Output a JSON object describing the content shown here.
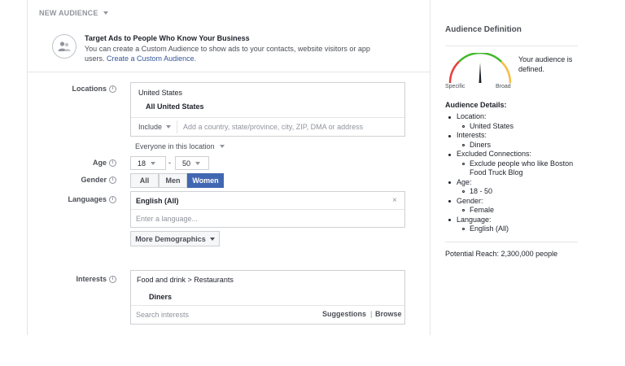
{
  "header": {
    "title": "NEW AUDIENCE"
  },
  "custom_audience": {
    "title": "Target Ads to People Who Know Your Business",
    "text": "You can create a Custom Audience to show ads to your contacts, website visitors or app users.",
    "link": "Create a Custom Audience."
  },
  "locations": {
    "label": "Locations",
    "country": "United States",
    "selected": "All United States",
    "include": "Include",
    "placeholder": "Add a country, state/province, city, ZIP, DMA or address",
    "everyone": "Everyone in this location"
  },
  "age": {
    "label": "Age",
    "min": "18",
    "dash": "-",
    "max": "50"
  },
  "gender": {
    "label": "Gender",
    "options": [
      "All",
      "Men",
      "Women"
    ],
    "selected": "Women"
  },
  "languages": {
    "label": "Languages",
    "value": "English (All)",
    "clear": "×",
    "placeholder": "Enter a language..."
  },
  "more_demographics": "More Demographics",
  "interests": {
    "label": "Interests",
    "path": "Food and drink > Restaurants",
    "item": "Diners",
    "placeholder": "Search interests",
    "suggestions": "Suggestions",
    "sep": "|",
    "browse": "Browse"
  },
  "definition": {
    "title": "Audience Definition",
    "status": "Your audience is defined.",
    "specific": "Specific",
    "broad": "Broad",
    "details_title": "Audience Details:",
    "details": [
      {
        "label": "Location:",
        "values": [
          "United States"
        ]
      },
      {
        "label": "Interests:",
        "values": [
          "Diners"
        ]
      },
      {
        "label": "Excluded Connections:",
        "values": [
          "Exclude people who like Boston Food Truck Blog"
        ]
      },
      {
        "label": "Age:",
        "values": [
          "18 - 50"
        ]
      },
      {
        "label": "Gender:",
        "values": [
          "Female"
        ]
      },
      {
        "label": "Language:",
        "values": [
          "English (All)"
        ]
      }
    ],
    "reach": "Potential Reach: 2,300,000 people"
  },
  "colors": {
    "accent": "#4267b2",
    "link": "#365899",
    "gauge_red": "#e4413b",
    "gauge_yellow": "#f5bd47",
    "gauge_green": "#42b72a"
  }
}
